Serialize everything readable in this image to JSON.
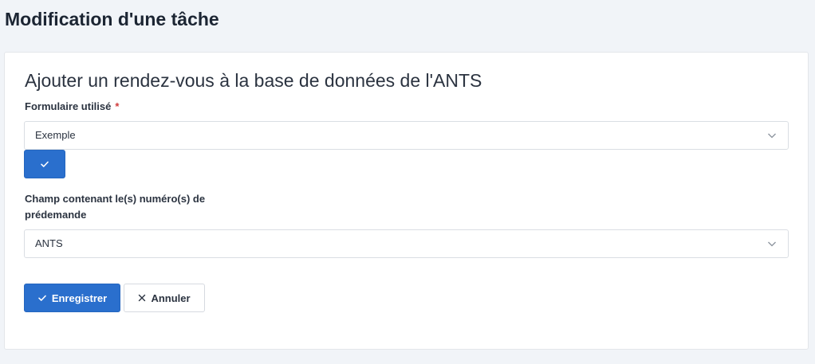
{
  "page": {
    "title": "Modification d'une tâche"
  },
  "card": {
    "title": "Ajouter un rendez-vous à la base de données de l'ANTS"
  },
  "form": {
    "form_field": {
      "label": "Formulaire utilisé",
      "required_mark": "*",
      "value": "Exemple"
    },
    "field_field": {
      "label": "Champ contenant le(s) numéro(s) de prédemande",
      "value": "ANTS"
    }
  },
  "actions": {
    "save_label": "Enregistrer",
    "cancel_label": "Annuler"
  },
  "icons": {
    "confirm": "check-icon",
    "save": "check-icon",
    "cancel": "close-icon",
    "dropdown": "chevron-down-icon"
  },
  "colors": {
    "primary": "#2a6fcd",
    "required": "#d03b3b",
    "page_background": "#f1f4f8"
  }
}
